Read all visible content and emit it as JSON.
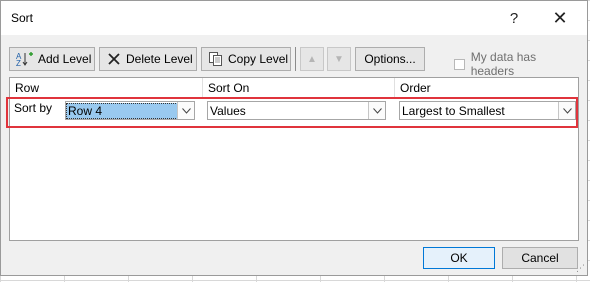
{
  "dialog": {
    "title": "Sort",
    "help_label": "?",
    "close_label": "✕"
  },
  "toolbar": {
    "add_label": "Add Level",
    "delete_label": "Delete Level",
    "copy_label": "Copy Level",
    "options_label": "Options...",
    "headers_label": "My data has headers",
    "headers_checked": false
  },
  "columns": {
    "c1": "Row",
    "c2": "Sort On",
    "c3": "Order"
  },
  "levels": [
    {
      "label": "Sort by",
      "row": "Row 4",
      "sort_on": "Values",
      "order": "Largest to Smallest"
    }
  ],
  "footer": {
    "ok_label": "OK",
    "cancel_label": "Cancel"
  },
  "colors": {
    "highlight": "#e0343c",
    "selection": "#99c9ef",
    "ok_border": "#0078d7"
  },
  "icons": {
    "add": "add-level-icon",
    "delete": "delete-x-icon",
    "copy": "copy-level-icon",
    "up": "move-up-icon",
    "down": "move-down-icon"
  }
}
